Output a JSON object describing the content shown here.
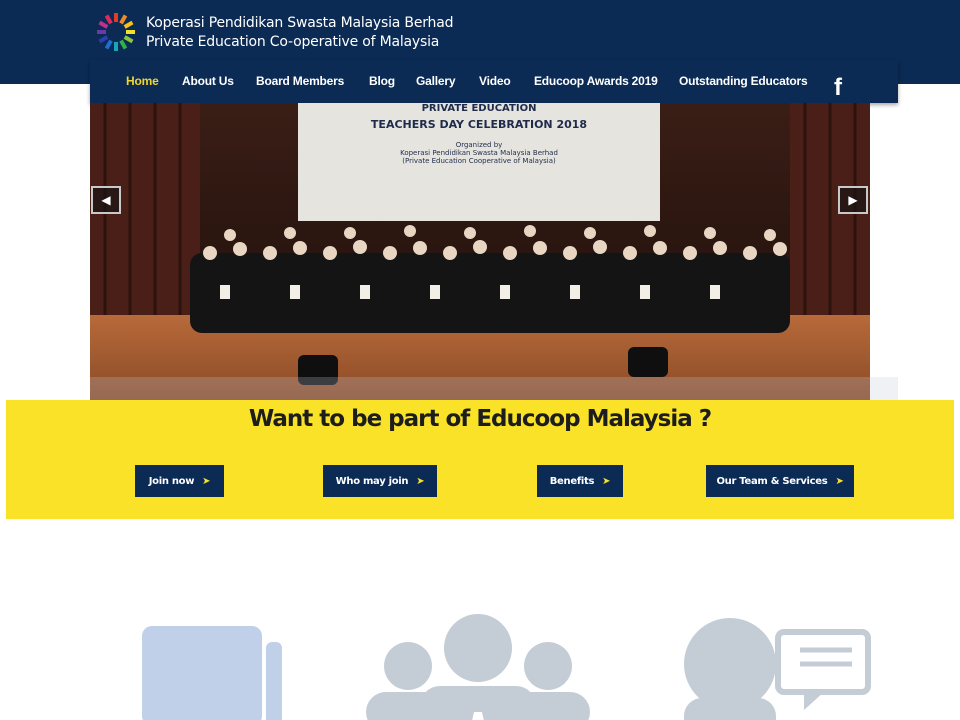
{
  "header": {
    "brand_line1": "Koperasi Pendidikan Swasta Malaysia Berhad",
    "brand_line2": "Private Education Co-operative of Malaysia"
  },
  "nav": {
    "items": [
      {
        "label": "Home",
        "active": true
      },
      {
        "label": "About Us"
      },
      {
        "label": "Board Members"
      },
      {
        "label": "Blog"
      },
      {
        "label": "Gallery"
      },
      {
        "label": "Video"
      },
      {
        "label": "Educoop Awards 2019"
      },
      {
        "label": "Outstanding Educators"
      }
    ],
    "facebook_glyph": "f"
  },
  "hero": {
    "banner_line1": "PRIVATE EDUCATION",
    "banner_line2": "TEACHERS DAY CELEBRATION 2018",
    "banner_line3": "Organized by",
    "banner_line4": "Koperasi Pendidikan Swasta Malaysia Berhad",
    "banner_line5": "(Private Education Cooperative of Malaysia)",
    "prev_icon": "chevron-left-icon",
    "next_icon": "chevron-right-icon"
  },
  "cta": {
    "title": "Want to be part of Educoop Malaysia ?",
    "buttons": [
      {
        "label": "Join now"
      },
      {
        "label": "Who may join"
      },
      {
        "label": "Benefits"
      },
      {
        "label": "Our Team & Services"
      }
    ]
  },
  "colors": {
    "navy": "#0b2b55",
    "yellow": "#f9e227",
    "active_nav": "#f2d52a",
    "icon_blue": "#bfd0e8",
    "icon_grey": "#c4ccd6"
  }
}
